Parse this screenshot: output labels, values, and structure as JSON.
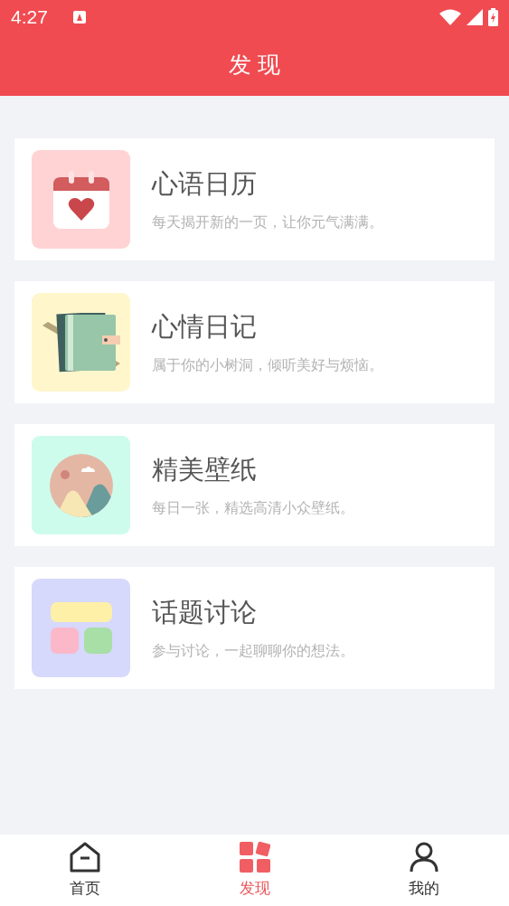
{
  "status_bar": {
    "time": "4:27"
  },
  "header": {
    "title": "发 现"
  },
  "cards": [
    {
      "kind": "calendar",
      "title": "心语日历",
      "subtitle": "每天揭开新的一页，让你元气满满。"
    },
    {
      "kind": "diary",
      "title": "心情日记",
      "subtitle": "属于你的小树洞，倾听美好与烦恼。"
    },
    {
      "kind": "wallpaper",
      "title": "精美壁纸",
      "subtitle": "每日一张，精选高清小众壁纸。"
    },
    {
      "kind": "topic",
      "title": "话题讨论",
      "subtitle": "参与讨论，一起聊聊你的想法。"
    }
  ],
  "tabs": [
    {
      "kind": "home",
      "label": "首页",
      "selected": false
    },
    {
      "kind": "discover",
      "label": "发现",
      "selected": true
    },
    {
      "kind": "profile",
      "label": "我的",
      "selected": false
    }
  ]
}
